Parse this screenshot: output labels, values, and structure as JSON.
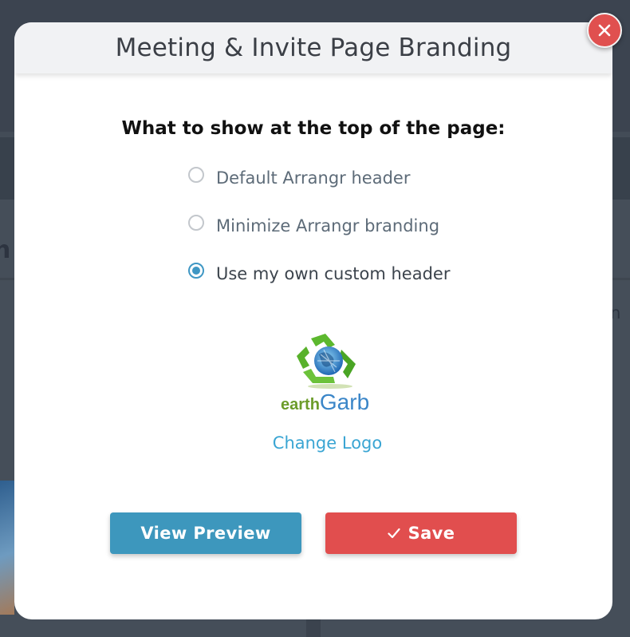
{
  "background": {
    "left_fragment": "n",
    "right_fragment": "r in"
  },
  "modal": {
    "title": "Meeting & Invite Page Branding",
    "close_icon": "close-icon",
    "question": "What to show at the top of the page:",
    "options": [
      {
        "label": "Default Arrangr header",
        "checked": false
      },
      {
        "label": "Minimize Arrangr branding",
        "checked": false
      },
      {
        "label": "Use my own custom header",
        "checked": true
      }
    ],
    "logo": {
      "part1": "earth",
      "part2": "Garb",
      "icon": "recycle-globe-icon"
    },
    "change_logo_label": "Change Logo",
    "buttons": {
      "preview_label": "View Preview",
      "save_label": "Save",
      "save_icon": "check-icon"
    }
  },
  "colors": {
    "accent_blue": "#3d97bd",
    "danger_red": "#e14e4e",
    "link_blue": "#3aa5d3",
    "radio_selected": "#3f97c4"
  }
}
